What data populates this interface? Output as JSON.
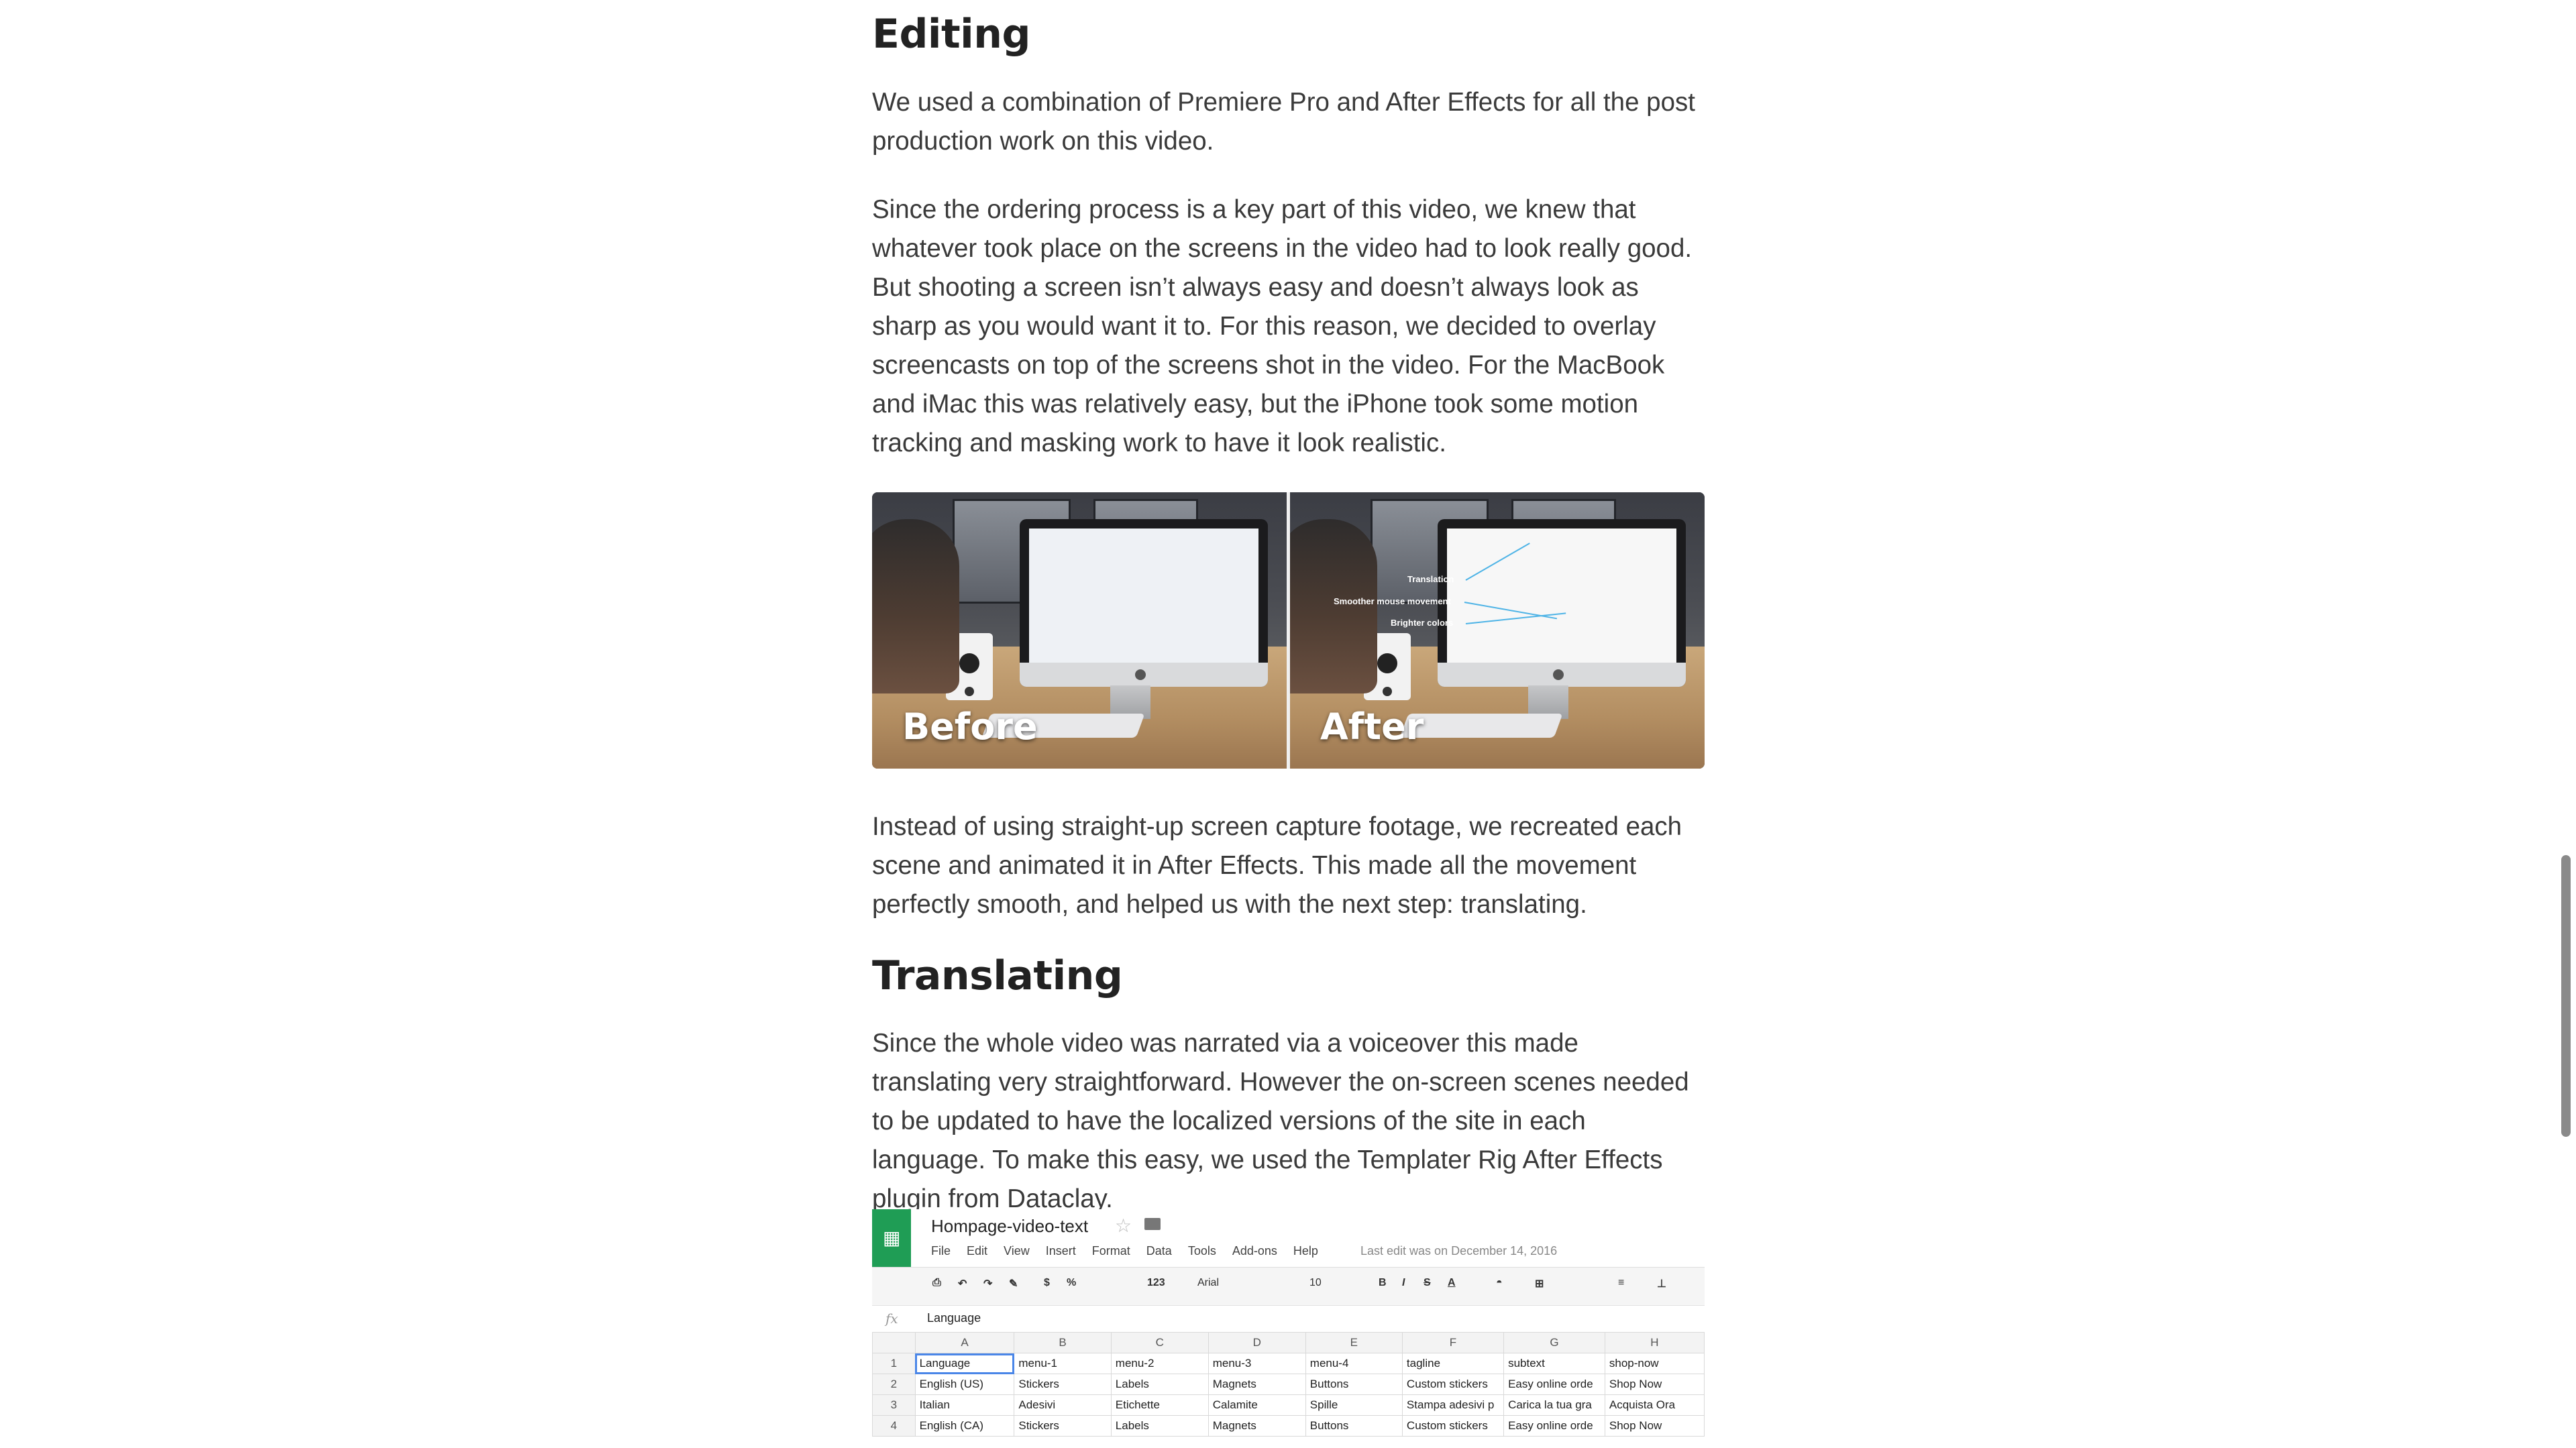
{
  "article": {
    "heading_editing": "Editing",
    "p1": "We used a combination of Premiere Pro and After Effects for all the post production work on this video.",
    "p2": "Since the ordering process is a key part of this video, we knew that whatever took place on the screens in the video had to look really good. But shooting a screen isn’t always easy and doesn’t always look as sharp as you would want it to. For this reason, we decided to overlay screencasts on top of the screens shot in the video. For the MacBook and iMac this was relatively easy, but the iPhone took some motion tracking and masking work to have it look realistic.",
    "image_before": "Before",
    "image_after": "After",
    "after_annotations": [
      "Translation",
      "Smoother mouse movement",
      "Brighter colors"
    ],
    "p3": "Instead of using straight-up screen capture footage, we recreated each scene and animated it in After Effects. This made all the movement perfectly smooth, and helped us with the next step: translating.",
    "heading_translating": "Translating",
    "p4": "Since the whole video was narrated via a voiceover this made translating very straightforward. However the on-screen scenes needed to be updated to have the localized versions of the site in each language. To make this easy, we used the Templater Rig After Effects plugin from Dataclay."
  },
  "spreadsheet": {
    "title": "Hompage-video-text",
    "menu": [
      "File",
      "Edit",
      "View",
      "Insert",
      "Format",
      "Data",
      "Tools",
      "Add-ons",
      "Help"
    ],
    "last_edit": "Last edit was on December 14, 2016",
    "toolbar": {
      "font": "Arial",
      "size": "10",
      "number_format": "123",
      "currency": "$",
      "percent": "%"
    },
    "formula_value": "Language",
    "columns": [
      "A",
      "B",
      "C",
      "D",
      "E",
      "F",
      "G",
      "H"
    ],
    "rows": [
      [
        "1",
        "Language",
        "menu-1",
        "menu-2",
        "menu-3",
        "menu-4",
        "tagline",
        "subtext",
        "shop-now"
      ],
      [
        "2",
        "English (US)",
        "Stickers",
        "Labels",
        "Magnets",
        "Buttons",
        "Custom stickers",
        "Easy online orde",
        "Shop Now"
      ],
      [
        "3",
        "Italian",
        "Adesivi",
        "Etichette",
        "Calamite",
        "Spille",
        "Stampa adesivi p",
        "Carica la tua gra",
        "Acquista Ora"
      ],
      [
        "4",
        "English (CA)",
        "Stickers",
        "Labels",
        "Magnets",
        "Buttons",
        "Custom stickers",
        "Easy online orde",
        "Shop Now"
      ]
    ]
  },
  "colors": {
    "sheets_green": "#1f9d55",
    "selection_blue": "#4a86e8",
    "annotation_line": "#4db3e6"
  }
}
